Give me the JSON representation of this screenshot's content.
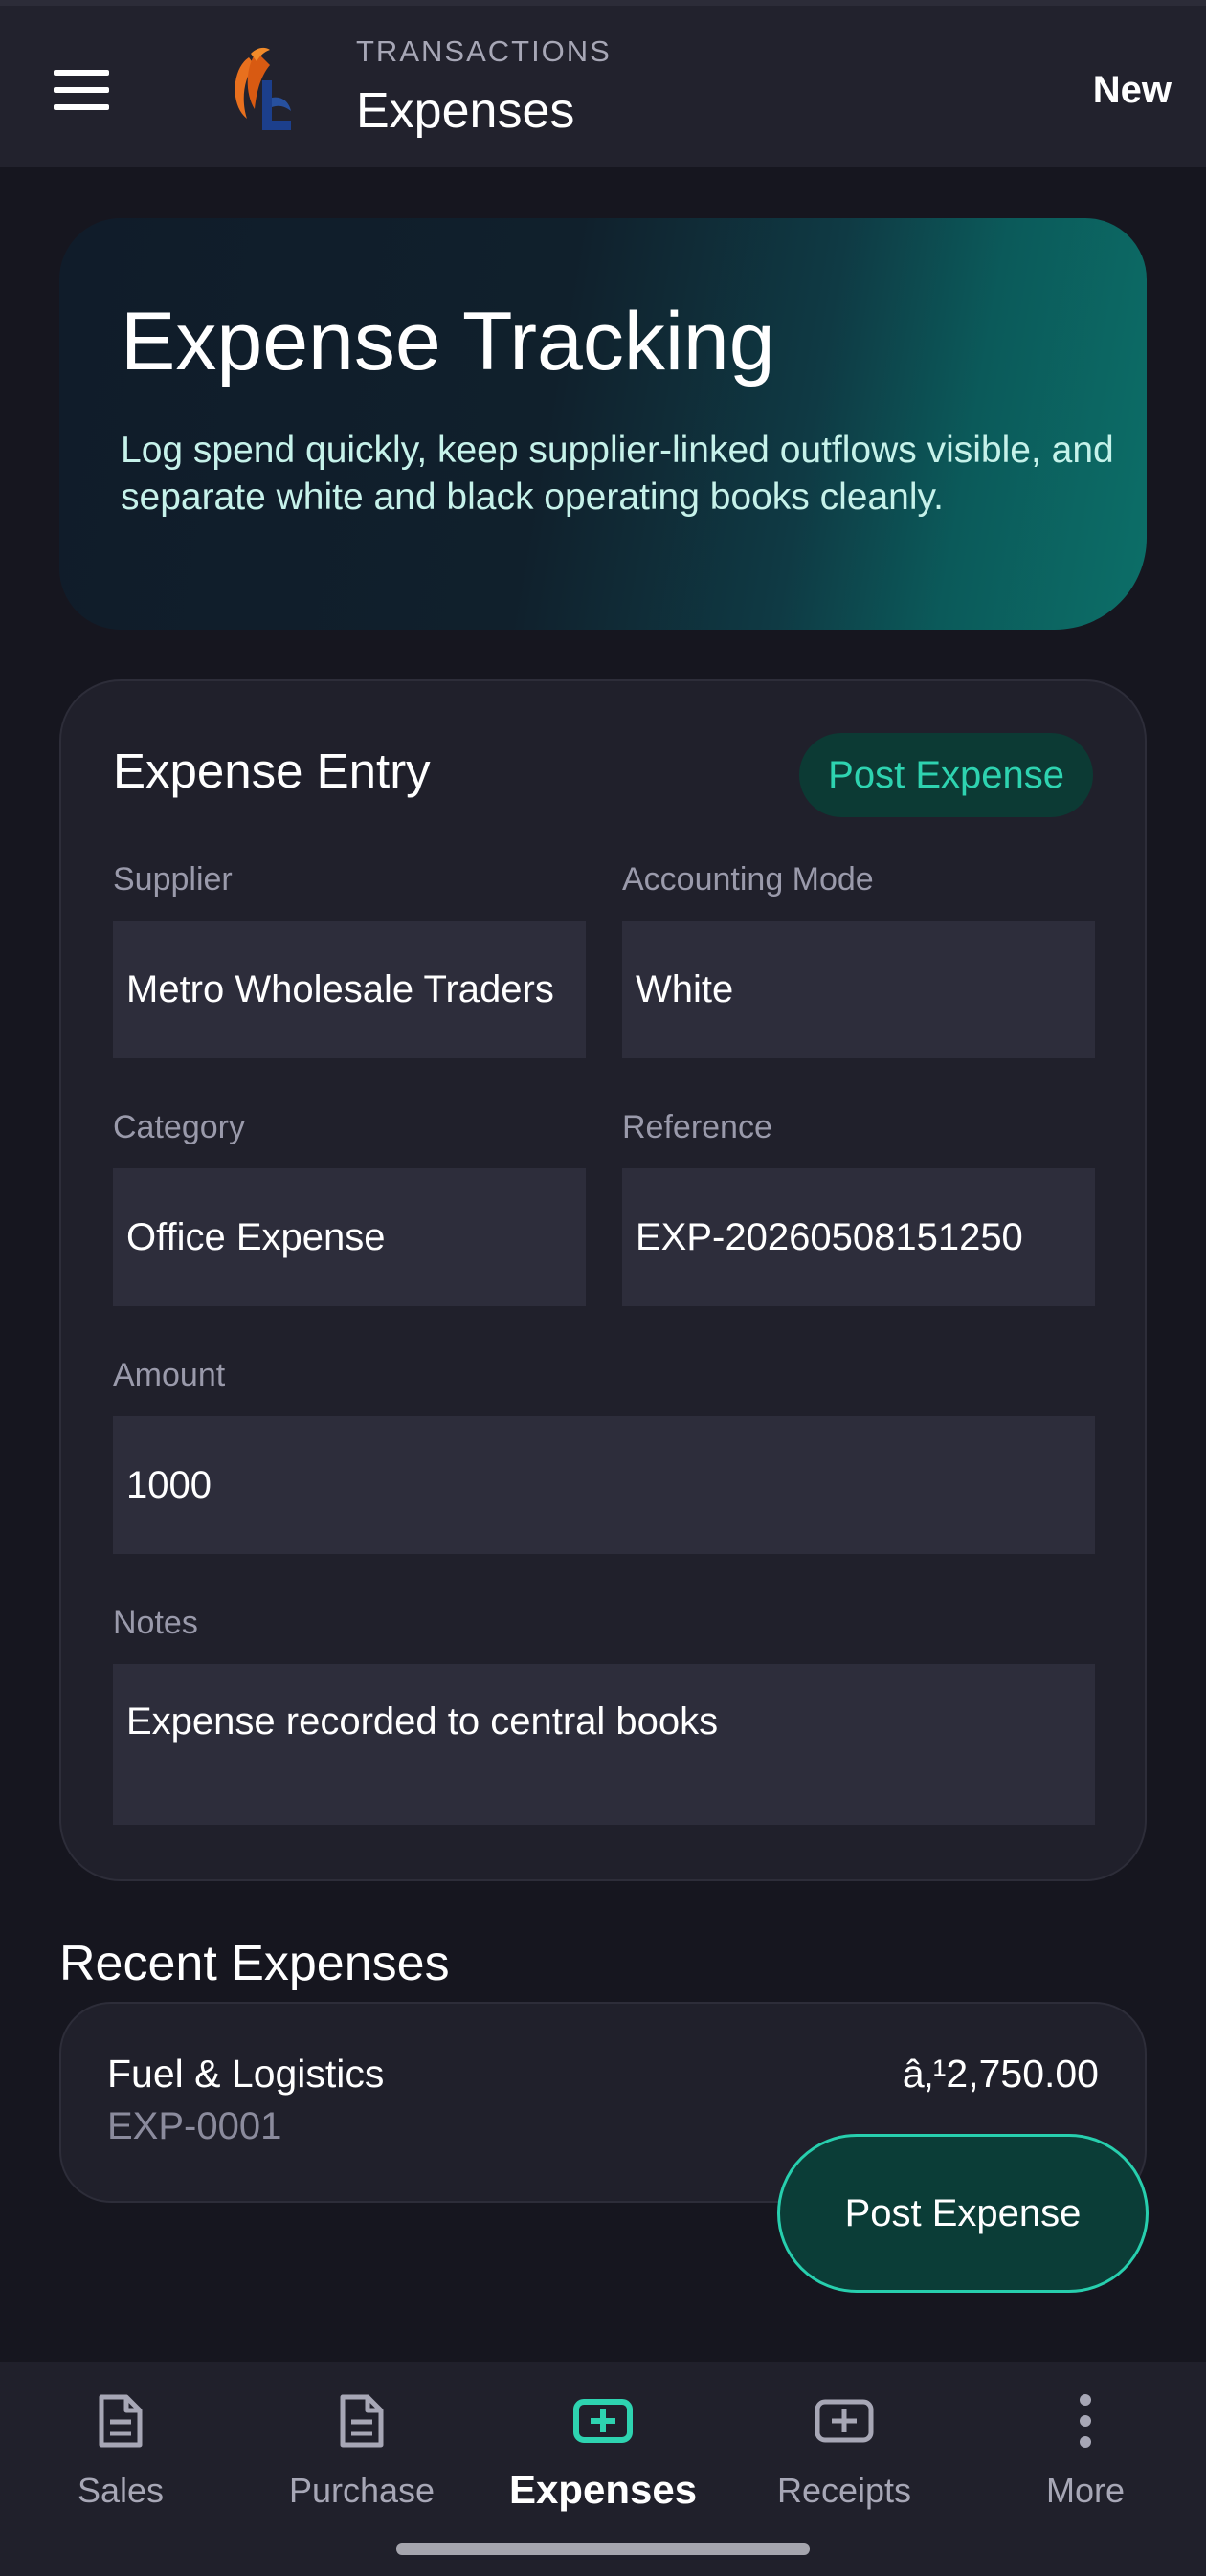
{
  "appbar": {
    "kicker": "TRANSACTIONS",
    "title": "Expenses",
    "new_label": "New"
  },
  "hero": {
    "title": "Expense Tracking",
    "subtitle": "Log spend quickly, keep supplier-linked outflows visible, and separate white and black operating books cleanly."
  },
  "form": {
    "title": "Expense Entry",
    "post_chip": "Post Expense",
    "supplier": {
      "label": "Supplier",
      "value": "Metro Wholesale Traders"
    },
    "accounting_mode": {
      "label": "Accounting Mode",
      "value": "White"
    },
    "category": {
      "label": "Category",
      "value": "Office Expense"
    },
    "reference": {
      "label": "Reference",
      "value": "EXP-20260508151250"
    },
    "amount": {
      "label": "Amount",
      "value": "1000"
    },
    "notes": {
      "label": "Notes",
      "value": "Expense recorded to central books"
    }
  },
  "recent": {
    "title": "Recent Expenses",
    "items": [
      {
        "name": "Fuel & Logistics",
        "ref": "EXP-0001",
        "amount": "â‚¹2,750.00"
      }
    ]
  },
  "fab_label": "Post Expense",
  "nav": {
    "items": [
      {
        "label": "Sales",
        "icon": "document-icon"
      },
      {
        "label": "Purchase",
        "icon": "document-icon"
      },
      {
        "label": "Expenses",
        "icon": "add-box-icon",
        "active": true
      },
      {
        "label": "Receipts",
        "icon": "add-box-icon"
      },
      {
        "label": "More",
        "icon": "more-vertical-icon"
      }
    ]
  },
  "colors": {
    "background": "#16161f",
    "surface": "#20202b",
    "field": "#2d2d3b",
    "accent": "#2ed3b0",
    "accent_dark": "#0b3d37"
  }
}
